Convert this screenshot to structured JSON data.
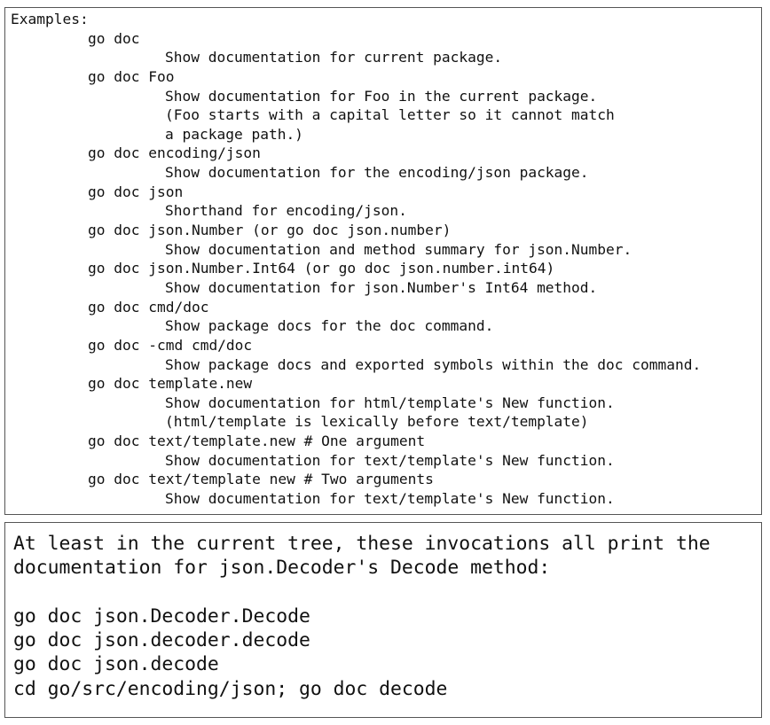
{
  "usage": {
    "heading": "Examples:",
    "examples": [
      {
        "command": "go doc",
        "description": [
          "Show documentation for current package."
        ]
      },
      {
        "command": "go doc Foo",
        "description": [
          "Show documentation for Foo in the current package.",
          "(Foo starts with a capital letter so it cannot match",
          "a package path.)"
        ]
      },
      {
        "command": "go doc encoding/json",
        "description": [
          "Show documentation for the encoding/json package."
        ]
      },
      {
        "command": "go doc json",
        "description": [
          "Shorthand for encoding/json."
        ]
      },
      {
        "command": "go doc json.Number (or go doc json.number)",
        "description": [
          "Show documentation and method summary for json.Number."
        ]
      },
      {
        "command": "go doc json.Number.Int64 (or go doc json.number.int64)",
        "description": [
          "Show documentation for json.Number's Int64 method."
        ]
      },
      {
        "command": "go doc cmd/doc",
        "description": [
          "Show package docs for the doc command."
        ]
      },
      {
        "command": "go doc -cmd cmd/doc",
        "description": [
          "Show package docs and exported symbols within the doc command."
        ]
      },
      {
        "command": "go doc template.new",
        "description": [
          "Show documentation for html/template's New function.",
          "(html/template is lexically before text/template)"
        ]
      },
      {
        "command": "go doc text/template.new # One argument",
        "description": [
          "Show documentation for text/template's New function."
        ]
      },
      {
        "command": "go doc text/template new # Two arguments",
        "description": [
          "Show documentation for text/template's New function."
        ]
      }
    ]
  },
  "note": {
    "intro": [
      "At least in the current tree, these invocations all print the",
      "documentation for json.Decoder's Decode method:"
    ],
    "commands": [
      "go doc json.Decoder.Decode",
      "go doc json.decoder.decode",
      "go doc json.decode",
      "cd go/src/encoding/json; go doc decode"
    ]
  }
}
